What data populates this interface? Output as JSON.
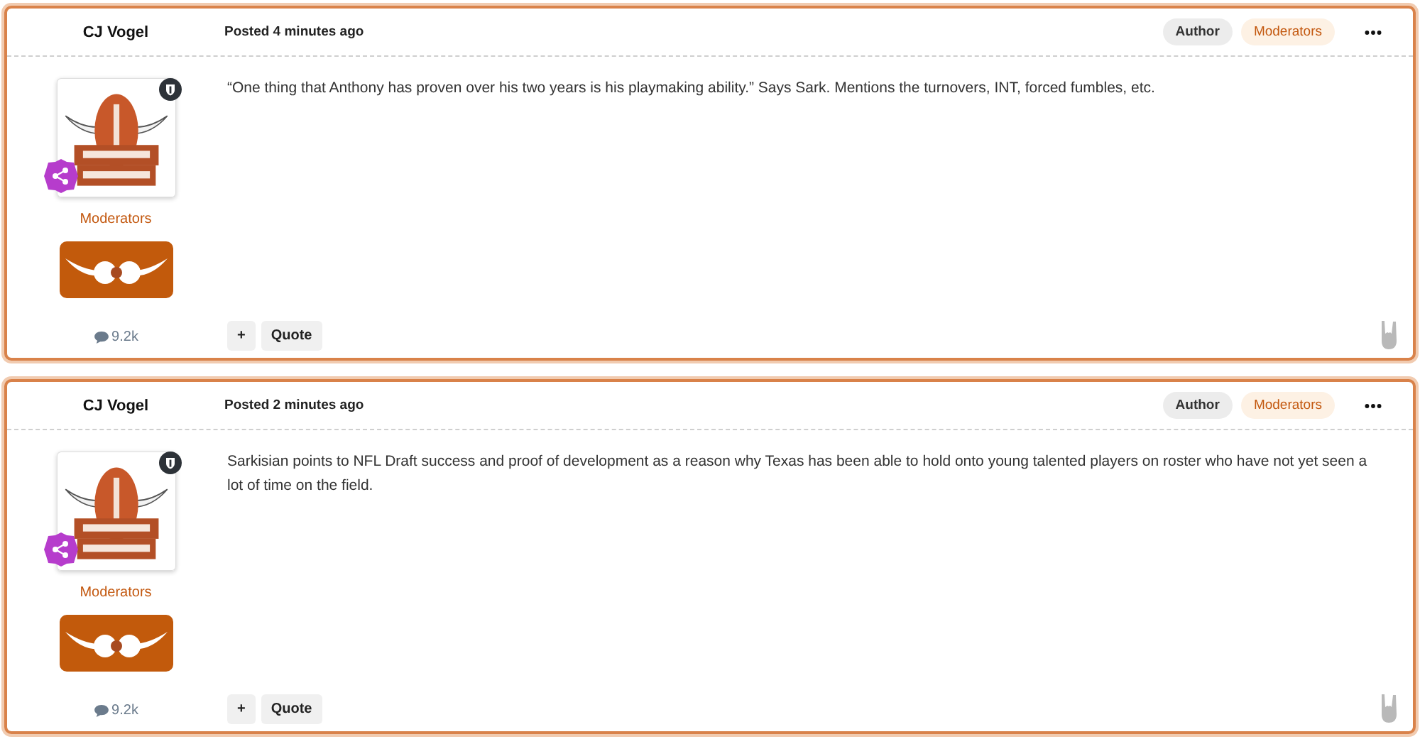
{
  "posts": [
    {
      "author": "CJ Vogel",
      "posted": "Posted 4 minutes ago",
      "badges": [
        {
          "label": "Author",
          "kind": "author"
        },
        {
          "label": "Moderators",
          "kind": "group"
        }
      ],
      "body": "“One thing that Anthony has proven over his two years is his playmaking ability.” Says Sark. Mentions the turnovers, INT, forced fumbles, etc.",
      "group": "Moderators",
      "post_count": "9.2k",
      "actions": [
        "+",
        "Quote"
      ]
    },
    {
      "author": "CJ Vogel",
      "posted": "Posted 2 minutes ago",
      "badges": [
        {
          "label": "Author",
          "kind": "author"
        },
        {
          "label": "Moderators",
          "kind": "group"
        }
      ],
      "body": "Sarkisian points to NFL Draft success and proof of development as a reason why Texas has been able to hold onto young talented players on roster who have not yet seen a lot of time on the field.",
      "group": "Moderators",
      "post_count": "9.2k",
      "actions": [
        "+",
        "Quote"
      ]
    }
  ]
}
